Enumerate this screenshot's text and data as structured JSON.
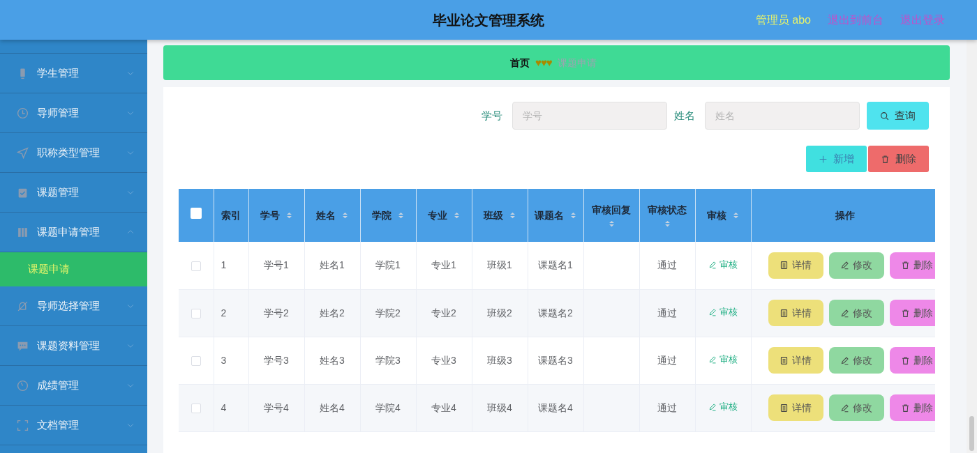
{
  "header": {
    "title": "毕业论文管理系统",
    "user": "管理员 abo",
    "links": [
      "退出到前台",
      "退出登录"
    ]
  },
  "sidebar": {
    "items": [
      {
        "label": "学生管理",
        "expanded": false
      },
      {
        "label": "导师管理",
        "expanded": false
      },
      {
        "label": "职称类型管理",
        "expanded": false
      },
      {
        "label": "课题管理",
        "expanded": false
      },
      {
        "label": "课题申请管理",
        "expanded": true,
        "children": [
          {
            "label": "课题申请",
            "selected": true
          }
        ]
      },
      {
        "label": "导师选择管理",
        "expanded": false
      },
      {
        "label": "课题资料管理",
        "expanded": false
      },
      {
        "label": "成绩管理",
        "expanded": false
      },
      {
        "label": "文档管理",
        "expanded": false
      }
    ]
  },
  "breadcrumb": {
    "home": "首页",
    "separator": "♥♥♥",
    "current": "课题申请"
  },
  "search": {
    "fields": [
      {
        "label": "学号",
        "placeholder": "学号"
      },
      {
        "label": "姓名",
        "placeholder": "姓名"
      }
    ],
    "button": "查询"
  },
  "actions": [
    {
      "kind": "add",
      "label": "新增"
    },
    {
      "kind": "delete",
      "label": "删除"
    }
  ],
  "table": {
    "select_all": {
      "checked": false
    },
    "columns": [
      {
        "label": "索引",
        "sortable": false
      },
      {
        "label": "学号",
        "sortable": true
      },
      {
        "label": "姓名",
        "sortable": true
      },
      {
        "label": "学院",
        "sortable": true
      },
      {
        "label": "专业",
        "sortable": true
      },
      {
        "label": "班级",
        "sortable": true
      },
      {
        "label": "课题名",
        "sortable": true
      },
      {
        "label": "审核回复",
        "sortable": true
      },
      {
        "label": "审核状态",
        "sortable": true
      },
      {
        "label": "审核",
        "sortable": true
      },
      {
        "label": "操作",
        "sortable": false
      }
    ],
    "rows": [
      {
        "checked": false,
        "index": "1",
        "student_no": "学号1",
        "name": "姓名1",
        "college": "学院1",
        "major": "专业1",
        "class": "班级1",
        "topic": "课题名1",
        "status": "通过",
        "review": "审核",
        "actions": [
          {
            "kind": "detail",
            "label": "详情"
          },
          {
            "kind": "edit",
            "label": "修改"
          },
          {
            "kind": "delete",
            "label": "删除"
          }
        ]
      },
      {
        "checked": false,
        "index": "2",
        "student_no": "学号2",
        "name": "姓名2",
        "college": "学院2",
        "major": "专业2",
        "class": "班级2",
        "topic": "课题名2",
        "status": "通过",
        "review": "审核",
        "actions": [
          {
            "kind": "detail",
            "label": "详情"
          },
          {
            "kind": "edit",
            "label": "修改"
          },
          {
            "kind": "delete",
            "label": "删除"
          }
        ]
      },
      {
        "checked": false,
        "index": "3",
        "student_no": "学号3",
        "name": "姓名3",
        "college": "学院3",
        "major": "专业3",
        "class": "班级3",
        "topic": "课题名3",
        "status": "通过",
        "review": "审核",
        "actions": [
          {
            "kind": "detail",
            "label": "详情"
          },
          {
            "kind": "edit",
            "label": "修改"
          },
          {
            "kind": "delete",
            "label": "删除"
          }
        ]
      },
      {
        "checked": false,
        "index": "4",
        "student_no": "学号4",
        "name": "姓名4",
        "college": "学院4",
        "major": "专业4",
        "class": "班级4",
        "topic": "课题名4",
        "status": "通过",
        "review": "审核",
        "actions": [
          {
            "kind": "detail",
            "label": "详情"
          },
          {
            "kind": "edit",
            "label": "修改"
          },
          {
            "kind": "delete",
            "label": "删除"
          }
        ]
      }
    ]
  }
}
